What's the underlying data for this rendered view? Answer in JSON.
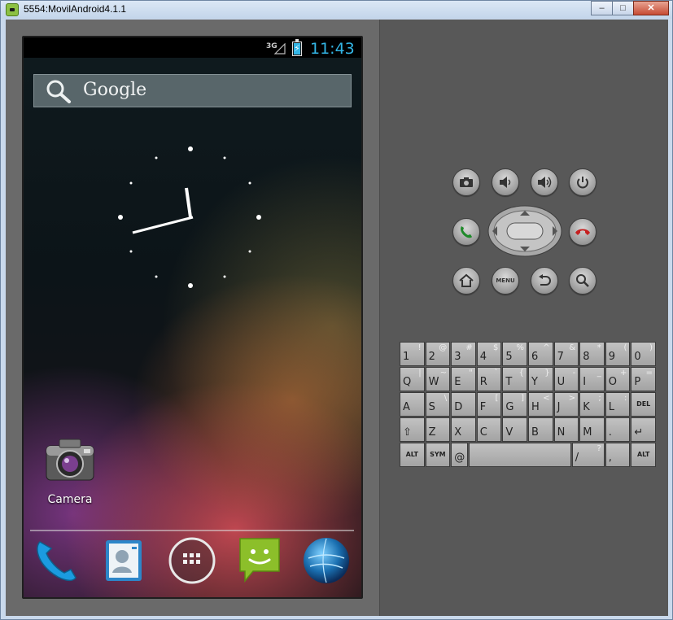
{
  "window": {
    "title": "5554:MovilAndroid4.1.1",
    "buttons": {
      "minimize": "–",
      "maximize": "□",
      "close": "✕"
    }
  },
  "statusbar": {
    "network": "3G",
    "time": "11:43",
    "battery_level": 0.85
  },
  "search": {
    "label": "Google"
  },
  "home": {
    "apps": [
      {
        "label": "Camera",
        "icon": "camera-icon"
      }
    ],
    "dock": [
      {
        "icon": "phone-icon"
      },
      {
        "icon": "contacts-icon"
      },
      {
        "icon": "app-drawer-icon"
      },
      {
        "icon": "messaging-icon"
      },
      {
        "icon": "browser-icon"
      }
    ]
  },
  "controls": {
    "menu_label": "MENU",
    "buttons": [
      "camera-icon",
      "volume-down-icon",
      "volume-up-icon",
      "power-icon",
      "call-icon",
      "end-call-icon",
      "home-icon",
      "menu",
      "back-icon",
      "search-icon"
    ]
  },
  "keyboard": {
    "row1": [
      [
        "1",
        "!"
      ],
      [
        "2",
        "@"
      ],
      [
        "3",
        "#"
      ],
      [
        "4",
        "$"
      ],
      [
        "5",
        "%"
      ],
      [
        "6",
        "^"
      ],
      [
        "7",
        "&"
      ],
      [
        "8",
        "*"
      ],
      [
        "9",
        "("
      ],
      [
        "0",
        ")"
      ]
    ],
    "row2": [
      [
        "Q",
        "|"
      ],
      [
        "W",
        "~"
      ],
      [
        "E",
        "\""
      ],
      [
        "R",
        "`"
      ],
      [
        "T",
        "{"
      ],
      [
        "Y",
        "}"
      ],
      [
        "U",
        "-"
      ],
      [
        "I",
        "_"
      ],
      [
        "O",
        "+"
      ],
      [
        "P",
        "="
      ]
    ],
    "row3": [
      [
        "A",
        ""
      ],
      [
        "S",
        "\\"
      ],
      [
        "D",
        ""
      ],
      [
        "F",
        "["
      ],
      [
        "G",
        "]"
      ],
      [
        "H",
        "<"
      ],
      [
        "J",
        ">"
      ],
      [
        "K",
        ";"
      ],
      [
        "L",
        ":"
      ],
      [
        "DEL",
        ""
      ]
    ],
    "row4": [
      [
        "⇧",
        ""
      ],
      [
        "Z",
        ""
      ],
      [
        "X",
        ""
      ],
      [
        "C",
        ""
      ],
      [
        "V",
        ""
      ],
      [
        "B",
        ""
      ],
      [
        "N",
        ""
      ],
      [
        "M",
        ""
      ],
      [
        ".",
        ""
      ],
      [
        "↵",
        ""
      ]
    ],
    "row5": [
      [
        "ALT",
        ""
      ],
      [
        "SYM",
        ""
      ],
      [
        "@",
        ""
      ],
      [
        "",
        ""
      ],
      [
        "/",
        "?"
      ],
      [
        ",",
        ""
      ],
      [
        "ALT",
        ""
      ]
    ]
  },
  "colors": {
    "accent": "#33b5e5"
  }
}
